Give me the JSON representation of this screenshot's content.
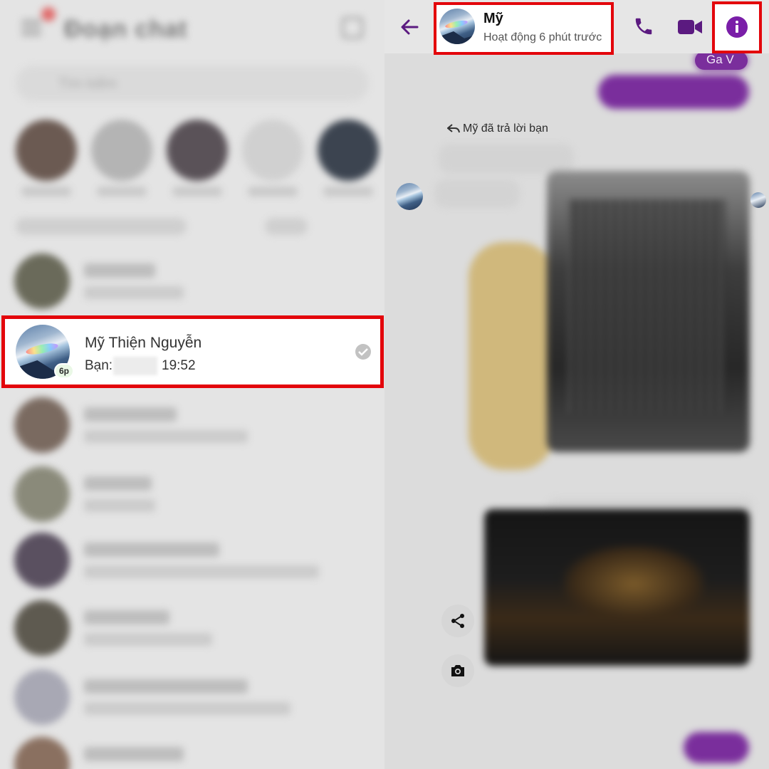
{
  "chat_list": {
    "highlighted_conversation": {
      "name": "Mỹ Thiện Nguyễn",
      "preview_sender": "Bạn:",
      "time": "19:52",
      "active_badge": "6p"
    }
  },
  "chat_header": {
    "contact_name": "Mỹ",
    "status": "Hoạt động 6 phút trước"
  },
  "conversation": {
    "top_bubble_text": "Ga V",
    "replied_indicator": "Mỹ đã trả lời bạn"
  },
  "icons": {
    "back": "back-arrow-icon",
    "call": "phone-icon",
    "video": "video-camera-icon",
    "info": "info-icon",
    "share": "share-icon",
    "camera": "camera-icon",
    "seen": "check-circle-icon"
  },
  "colors": {
    "accent": "#7a1ea8",
    "highlight_border": "#e3050b",
    "read_check": "#c2c2c2"
  }
}
